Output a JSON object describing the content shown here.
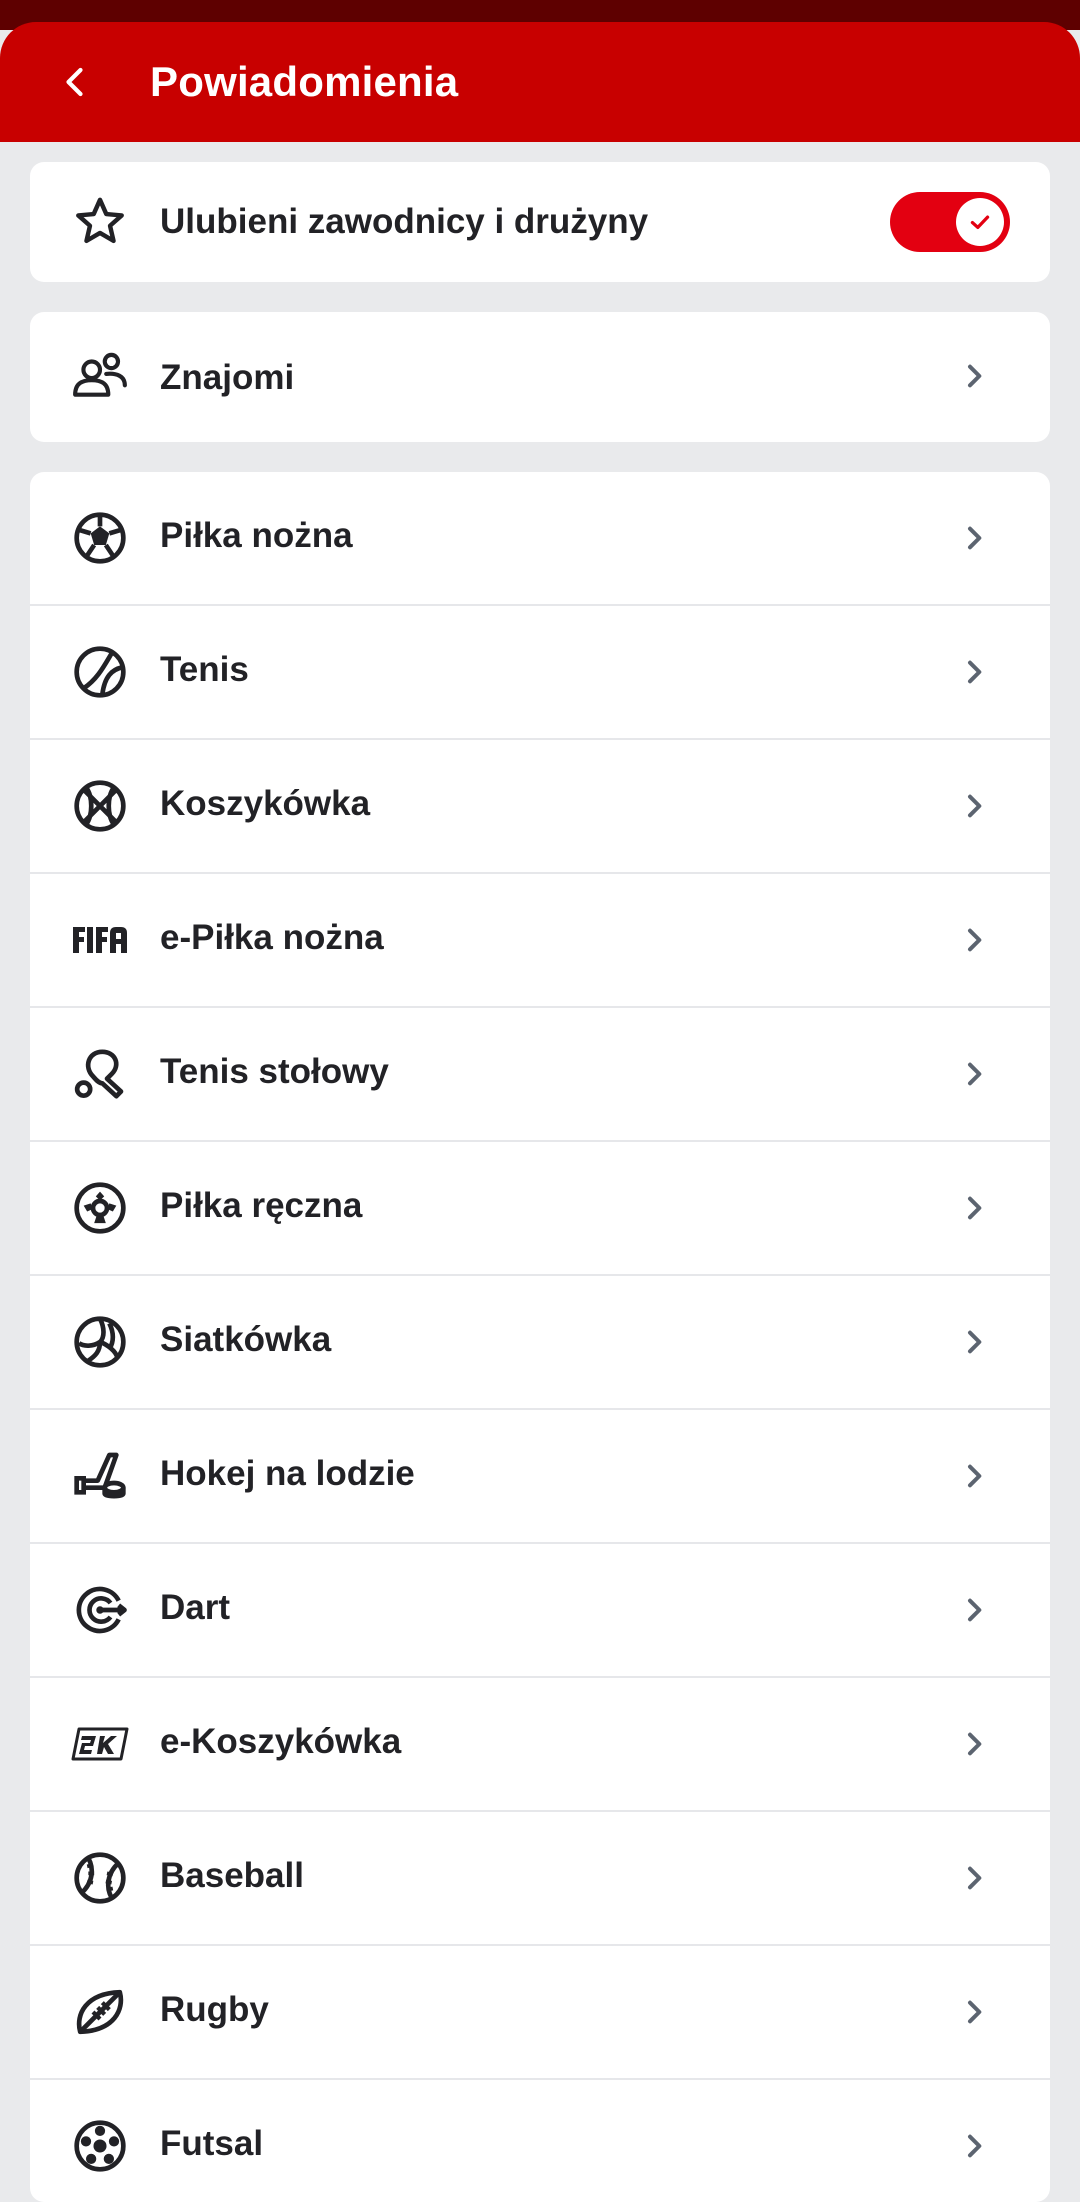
{
  "header": {
    "title": "Powiadomienia"
  },
  "favorites": {
    "label": "Ulubieni zawodnicy i drużyny",
    "toggle_on": true,
    "icon": "star-icon"
  },
  "friends": {
    "label": "Znajomi",
    "icon": "friends-icon"
  },
  "sports": [
    {
      "label": "Piłka nożna",
      "icon": "football-icon"
    },
    {
      "label": "Tenis",
      "icon": "tennis-icon"
    },
    {
      "label": "Koszykówka",
      "icon": "basketball-icon"
    },
    {
      "label": "e-Piłka nożna",
      "icon": "fifa-icon"
    },
    {
      "label": "Tenis stołowy",
      "icon": "table-tennis-icon"
    },
    {
      "label": "Piłka ręczna",
      "icon": "handball-icon"
    },
    {
      "label": "Siatkówka",
      "icon": "volleyball-icon"
    },
    {
      "label": "Hokej na lodzie",
      "icon": "ice-hockey-icon"
    },
    {
      "label": "Dart",
      "icon": "darts-icon"
    },
    {
      "label": "e-Koszykówka",
      "icon": "2k-icon"
    },
    {
      "label": "Baseball",
      "icon": "baseball-icon"
    },
    {
      "label": "Rugby",
      "icon": "rugby-icon"
    },
    {
      "label": "Futsal",
      "icon": "futsal-icon"
    }
  ],
  "colors": {
    "header": "#c80000",
    "status_bar": "#5e0000",
    "toggle": "#e30011",
    "background": "#e9eaec"
  }
}
